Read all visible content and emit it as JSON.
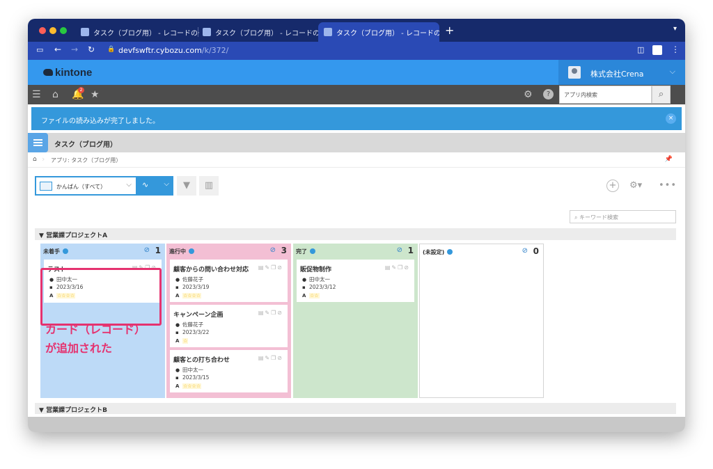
{
  "browser": {
    "tabs": [
      {
        "label": "タスク（ブログ用） - レコードの一覧",
        "active": false
      },
      {
        "label": "タスク（ブログ用） - レコードの一覧",
        "active": false
      },
      {
        "label": "タスク（ブログ用） - レコードの一",
        "active": true
      }
    ],
    "close_glyph": "×",
    "new_tab": "+",
    "url_host": "devfswftr.cybozu.com",
    "url_path": "/k/372/"
  },
  "header": {
    "logo": "kintone",
    "company": "株式会社Crena"
  },
  "toolbar": {
    "notification_count": "2",
    "app_search_placeholder": "アプリ内検索"
  },
  "notification": {
    "message": "ファイルの読み込みが完了しました。"
  },
  "app": {
    "title": "タスク（ブログ用）",
    "breadcrumb": "アプリ: タスク（ブログ用）"
  },
  "view": {
    "selected": "かんばん（すべて）",
    "keyword_placeholder": "キーワード検索"
  },
  "groups": [
    {
      "label": "営業課プロジェクトA"
    },
    {
      "label": "営業課プロジェクトB"
    }
  ],
  "columns": [
    {
      "label": "未着手",
      "count": "1",
      "color": "#bddaf7",
      "cards": [
        {
          "title": "テスト",
          "person": "田中太一",
          "date": "2023/3/16",
          "priority": "A",
          "stars": "☆☆☆☆"
        }
      ]
    },
    {
      "label": "進行中",
      "count": "3",
      "color": "#f3bfd4",
      "cards": [
        {
          "title": "顧客からの問い合わせ対応",
          "person": "佐藤花子",
          "date": "2023/3/19",
          "priority": "A",
          "stars": "☆☆☆☆"
        },
        {
          "title": "キャンペーン企画",
          "person": "佐藤花子",
          "date": "2023/3/22",
          "priority": "A",
          "stars": "☆"
        },
        {
          "title": "顧客との打ち合わせ",
          "person": "田中太一",
          "date": "2023/3/15",
          "priority": "A",
          "stars": "☆☆☆☆"
        }
      ]
    },
    {
      "label": "完了",
      "count": "1",
      "color": "#cde6cc",
      "cards": [
        {
          "title": "販促物制作",
          "person": "田中太一",
          "date": "2023/3/12",
          "priority": "A",
          "stars": "☆☆"
        }
      ]
    },
    {
      "label": "(未設定)",
      "count": "0",
      "color": "#ffffff",
      "cards": []
    }
  ],
  "annotation": {
    "line1": "カード（レコード）",
    "line2": "が追加された",
    "color": "#e5326f"
  }
}
